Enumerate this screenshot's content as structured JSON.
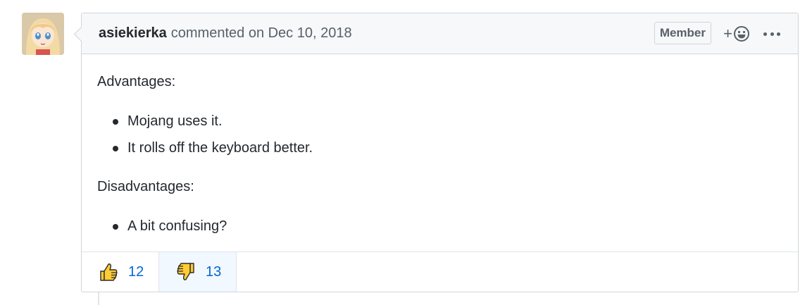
{
  "comment": {
    "author": "asiekierka",
    "action_text": "commented on Dec 10, 2018",
    "badge": "Member",
    "add_reaction_plus": "+",
    "body": {
      "advantages_heading": "Advantages:",
      "advantages": [
        "Mojang uses it.",
        "It rolls off the keyboard better."
      ],
      "disadvantages_heading": "Disadvantages:",
      "disadvantages": [
        "A bit confusing?"
      ]
    },
    "reactions": [
      {
        "icon": "thumbs-up-icon",
        "count": "12",
        "active": false
      },
      {
        "icon": "thumbs-down-icon",
        "count": "13",
        "active": true
      }
    ]
  },
  "colors": {
    "link": "#0366d6",
    "header_bg": "#f6f8fa",
    "border": "#d1d5da",
    "emoji_yellow": "#ffcc33",
    "active_reaction_bg": "#f1f8ff"
  }
}
